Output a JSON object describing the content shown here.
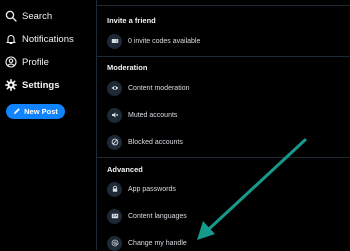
{
  "sidebar": {
    "items": [
      {
        "label": "Search",
        "icon": "search-icon"
      },
      {
        "label": "Notifications",
        "icon": "bell-icon"
      },
      {
        "label": "Profile",
        "icon": "user-circle-icon"
      },
      {
        "label": "Settings",
        "icon": "gear-icon",
        "active": true
      }
    ],
    "new_post_label": "New Post"
  },
  "settings": {
    "invite": {
      "title": "Invite a friend",
      "items": [
        {
          "label": "0 invite codes available",
          "icon": "ticket-icon"
        }
      ]
    },
    "moderation": {
      "title": "Moderation",
      "items": [
        {
          "label": "Content moderation",
          "icon": "eye-icon"
        },
        {
          "label": "Muted accounts",
          "icon": "mute-icon"
        },
        {
          "label": "Blocked accounts",
          "icon": "block-icon"
        }
      ]
    },
    "advanced": {
      "title": "Advanced",
      "items": [
        {
          "label": "App passwords",
          "icon": "lock-icon"
        },
        {
          "label": "Content languages",
          "icon": "language-icon"
        },
        {
          "label": "Change my handle",
          "icon": "at-icon"
        }
      ]
    }
  },
  "colors": {
    "accent": "#1083fe",
    "annotation_arrow": "#159a8c",
    "background": "#000000",
    "icon_circle": "#1e2936"
  }
}
